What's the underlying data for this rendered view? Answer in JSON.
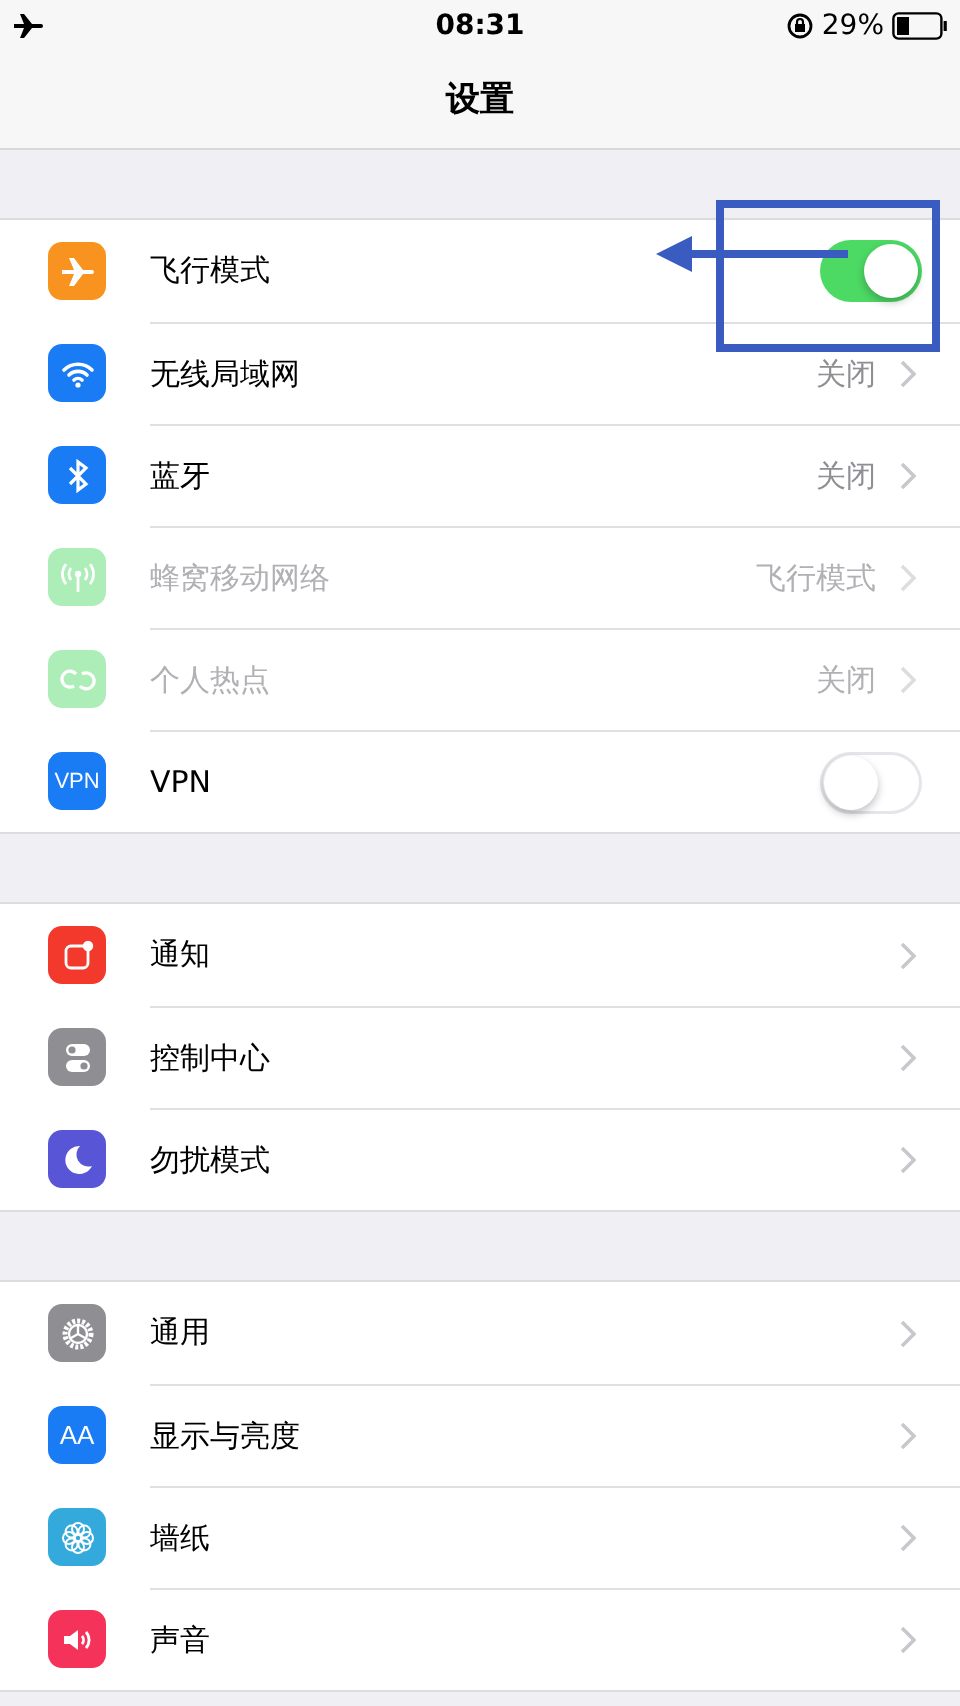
{
  "status_bar": {
    "time": "08:31",
    "battery": "29%"
  },
  "nav": {
    "title": "设置"
  },
  "groups": [
    {
      "rows": [
        {
          "label": "飞行模式",
          "kind": "toggle",
          "on": true,
          "disabled": false
        },
        {
          "label": "无线局域网",
          "kind": "link",
          "value": "关闭",
          "disabled": false
        },
        {
          "label": "蓝牙",
          "kind": "link",
          "value": "关闭",
          "disabled": false
        },
        {
          "label": "蜂窝移动网络",
          "kind": "link",
          "value": "飞行模式",
          "disabled": true
        },
        {
          "label": "个人热点",
          "kind": "link",
          "value": "关闭",
          "disabled": true
        },
        {
          "label": "VPN",
          "kind": "toggle",
          "on": false,
          "disabled": false,
          "icon_text": "VPN"
        }
      ]
    },
    {
      "rows": [
        {
          "label": "通知",
          "kind": "link",
          "disabled": false
        },
        {
          "label": "控制中心",
          "kind": "link",
          "disabled": false
        },
        {
          "label": "勿扰模式",
          "kind": "link",
          "disabled": false
        }
      ]
    },
    {
      "rows": [
        {
          "label": "通用",
          "kind": "link",
          "disabled": false
        },
        {
          "label": "显示与亮度",
          "kind": "link",
          "disabled": false,
          "icon_text": "AA"
        },
        {
          "label": "墙纸",
          "kind": "link",
          "disabled": false
        },
        {
          "label": "声音",
          "kind": "link",
          "disabled": false
        }
      ]
    }
  ]
}
